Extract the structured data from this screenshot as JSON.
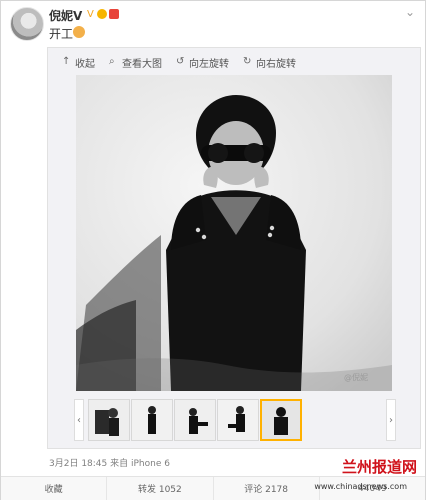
{
  "post": {
    "username": "倪妮V",
    "text": "开工",
    "meta": "3月2日 18:45 来自 iPhone 6"
  },
  "toolbar": {
    "collapse": "收起",
    "view_large": "查看大图",
    "rotate_left": "向左旋转",
    "rotate_right": "向右旋转"
  },
  "photo": {
    "watermark": "@倪妮"
  },
  "actions": {
    "favorite": "收藏",
    "repost": "转发 1052",
    "comment": "评论 2178",
    "like": "44049"
  },
  "site": {
    "brand": "兰州报道网",
    "url": "www.chinadsnews.com"
  },
  "icons": {
    "collapse": "arrow-up-icon",
    "view_large": "magnifier-icon",
    "rotate_left": "rotate-left-icon",
    "rotate_right": "rotate-right-icon",
    "more": "chevron-down-icon"
  }
}
